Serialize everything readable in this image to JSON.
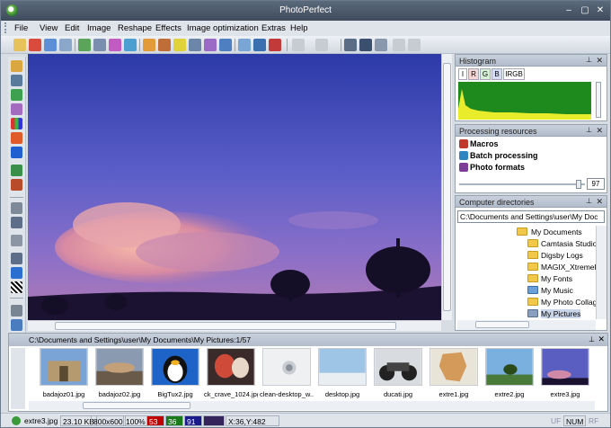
{
  "window": {
    "title": "PhotoPerfect"
  },
  "menu": [
    "File",
    "View",
    "Edit",
    "Image",
    "Reshape",
    "Effects",
    "Image optimization",
    "Extras",
    "Help"
  ],
  "histogram": {
    "title": "Histogram",
    "tabs": [
      "I",
      "R",
      "G",
      "B",
      "IRGB"
    ]
  },
  "processing": {
    "title": "Processing resources",
    "items": [
      "Macros",
      "Batch processing",
      "Photo formats"
    ],
    "slider_value": "97"
  },
  "directories": {
    "title": "Computer directories",
    "path": "C:\\Documents and Settings\\user\\My Doc",
    "items": [
      "My Documents",
      "Camtasia Studio",
      "Digsby Logs",
      "MAGIX_XtremeP",
      "My Fonts",
      "My Music",
      "My Photo Collag",
      "My Pictures"
    ]
  },
  "browser": {
    "path": "C:\\Documents and Settings\\user\\My Documents\\My Pictures:1/57",
    "thumbnails": [
      "badajoz01.jpg",
      "badajoz02.jpg",
      "BigTux2.jpg",
      "ck_crave_1024.jpg",
      "clean-desktop_w...",
      "desktop.jpg",
      "ducati.jpg",
      "extre1.jpg",
      "extre2.jpg",
      "extre3.jpg"
    ]
  },
  "status": {
    "file": "extre3.jpg",
    "size": "23.10 KB",
    "dims": "800x600",
    "zoom": "100%",
    "r": "53",
    "g": "36",
    "b": "91",
    "coords": "X:36,Y:482",
    "uf": "UF",
    "num": "NUM",
    "rf": "RF"
  }
}
